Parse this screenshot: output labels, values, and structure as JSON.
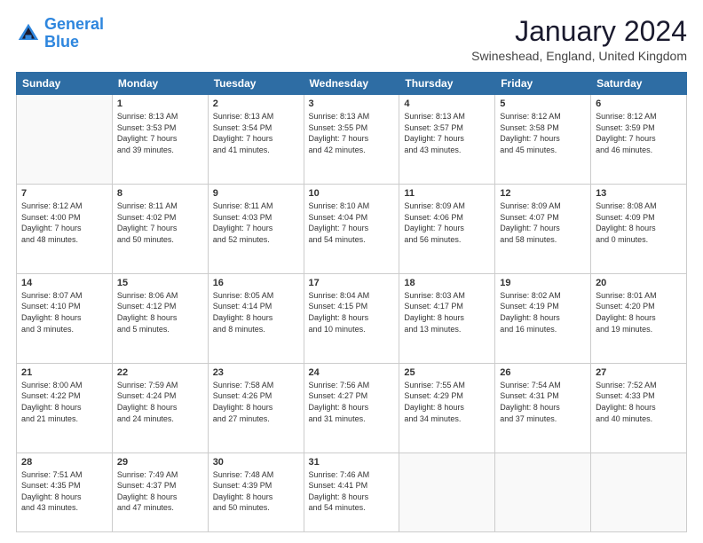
{
  "logo": {
    "line1": "General",
    "line2": "Blue"
  },
  "title": "January 2024",
  "location": "Swineshead, England, United Kingdom",
  "days_header": [
    "Sunday",
    "Monday",
    "Tuesday",
    "Wednesday",
    "Thursday",
    "Friday",
    "Saturday"
  ],
  "weeks": [
    [
      {
        "day": "",
        "info": ""
      },
      {
        "day": "1",
        "info": "Sunrise: 8:13 AM\nSunset: 3:53 PM\nDaylight: 7 hours\nand 39 minutes."
      },
      {
        "day": "2",
        "info": "Sunrise: 8:13 AM\nSunset: 3:54 PM\nDaylight: 7 hours\nand 41 minutes."
      },
      {
        "day": "3",
        "info": "Sunrise: 8:13 AM\nSunset: 3:55 PM\nDaylight: 7 hours\nand 42 minutes."
      },
      {
        "day": "4",
        "info": "Sunrise: 8:13 AM\nSunset: 3:57 PM\nDaylight: 7 hours\nand 43 minutes."
      },
      {
        "day": "5",
        "info": "Sunrise: 8:12 AM\nSunset: 3:58 PM\nDaylight: 7 hours\nand 45 minutes."
      },
      {
        "day": "6",
        "info": "Sunrise: 8:12 AM\nSunset: 3:59 PM\nDaylight: 7 hours\nand 46 minutes."
      }
    ],
    [
      {
        "day": "7",
        "info": "Sunrise: 8:12 AM\nSunset: 4:00 PM\nDaylight: 7 hours\nand 48 minutes."
      },
      {
        "day": "8",
        "info": "Sunrise: 8:11 AM\nSunset: 4:02 PM\nDaylight: 7 hours\nand 50 minutes."
      },
      {
        "day": "9",
        "info": "Sunrise: 8:11 AM\nSunset: 4:03 PM\nDaylight: 7 hours\nand 52 minutes."
      },
      {
        "day": "10",
        "info": "Sunrise: 8:10 AM\nSunset: 4:04 PM\nDaylight: 7 hours\nand 54 minutes."
      },
      {
        "day": "11",
        "info": "Sunrise: 8:09 AM\nSunset: 4:06 PM\nDaylight: 7 hours\nand 56 minutes."
      },
      {
        "day": "12",
        "info": "Sunrise: 8:09 AM\nSunset: 4:07 PM\nDaylight: 7 hours\nand 58 minutes."
      },
      {
        "day": "13",
        "info": "Sunrise: 8:08 AM\nSunset: 4:09 PM\nDaylight: 8 hours\nand 0 minutes."
      }
    ],
    [
      {
        "day": "14",
        "info": "Sunrise: 8:07 AM\nSunset: 4:10 PM\nDaylight: 8 hours\nand 3 minutes."
      },
      {
        "day": "15",
        "info": "Sunrise: 8:06 AM\nSunset: 4:12 PM\nDaylight: 8 hours\nand 5 minutes."
      },
      {
        "day": "16",
        "info": "Sunrise: 8:05 AM\nSunset: 4:14 PM\nDaylight: 8 hours\nand 8 minutes."
      },
      {
        "day": "17",
        "info": "Sunrise: 8:04 AM\nSunset: 4:15 PM\nDaylight: 8 hours\nand 10 minutes."
      },
      {
        "day": "18",
        "info": "Sunrise: 8:03 AM\nSunset: 4:17 PM\nDaylight: 8 hours\nand 13 minutes."
      },
      {
        "day": "19",
        "info": "Sunrise: 8:02 AM\nSunset: 4:19 PM\nDaylight: 8 hours\nand 16 minutes."
      },
      {
        "day": "20",
        "info": "Sunrise: 8:01 AM\nSunset: 4:20 PM\nDaylight: 8 hours\nand 19 minutes."
      }
    ],
    [
      {
        "day": "21",
        "info": "Sunrise: 8:00 AM\nSunset: 4:22 PM\nDaylight: 8 hours\nand 21 minutes."
      },
      {
        "day": "22",
        "info": "Sunrise: 7:59 AM\nSunset: 4:24 PM\nDaylight: 8 hours\nand 24 minutes."
      },
      {
        "day": "23",
        "info": "Sunrise: 7:58 AM\nSunset: 4:26 PM\nDaylight: 8 hours\nand 27 minutes."
      },
      {
        "day": "24",
        "info": "Sunrise: 7:56 AM\nSunset: 4:27 PM\nDaylight: 8 hours\nand 31 minutes."
      },
      {
        "day": "25",
        "info": "Sunrise: 7:55 AM\nSunset: 4:29 PM\nDaylight: 8 hours\nand 34 minutes."
      },
      {
        "day": "26",
        "info": "Sunrise: 7:54 AM\nSunset: 4:31 PM\nDaylight: 8 hours\nand 37 minutes."
      },
      {
        "day": "27",
        "info": "Sunrise: 7:52 AM\nSunset: 4:33 PM\nDaylight: 8 hours\nand 40 minutes."
      }
    ],
    [
      {
        "day": "28",
        "info": "Sunrise: 7:51 AM\nSunset: 4:35 PM\nDaylight: 8 hours\nand 43 minutes."
      },
      {
        "day": "29",
        "info": "Sunrise: 7:49 AM\nSunset: 4:37 PM\nDaylight: 8 hours\nand 47 minutes."
      },
      {
        "day": "30",
        "info": "Sunrise: 7:48 AM\nSunset: 4:39 PM\nDaylight: 8 hours\nand 50 minutes."
      },
      {
        "day": "31",
        "info": "Sunrise: 7:46 AM\nSunset: 4:41 PM\nDaylight: 8 hours\nand 54 minutes."
      },
      {
        "day": "",
        "info": ""
      },
      {
        "day": "",
        "info": ""
      },
      {
        "day": "",
        "info": ""
      }
    ]
  ]
}
